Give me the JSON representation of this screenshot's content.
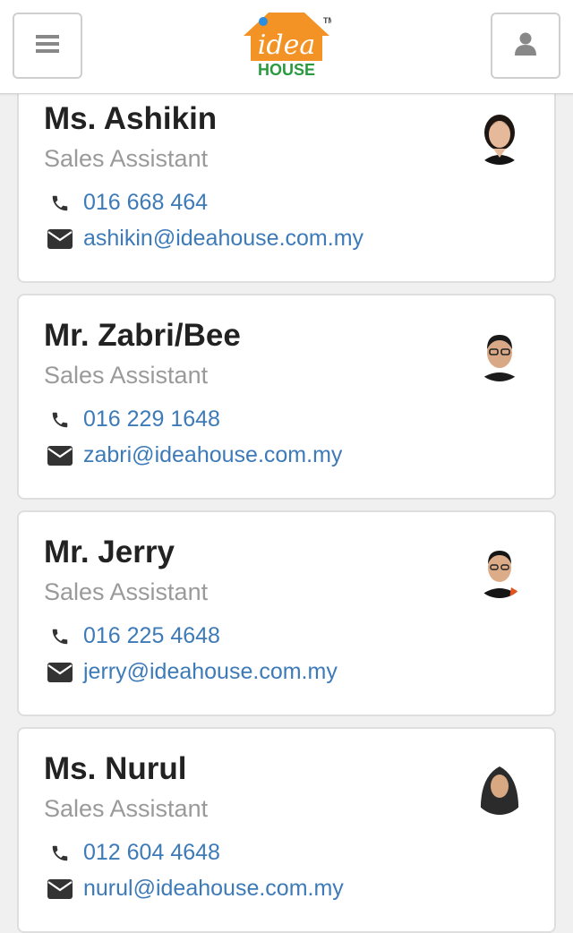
{
  "header": {
    "logo_text": "idea",
    "logo_subtext": "HOUSE",
    "logo_tm": "TM",
    "menu_icon": "hamburger-menu-icon",
    "user_icon": "user-icon"
  },
  "contacts": [
    {
      "name": "Ms. Ashikin",
      "role": "Sales Assistant",
      "phone": "016 668 464",
      "email": "ashikin@ideahouse.com.my"
    },
    {
      "name": "Mr. Zabri/Bee",
      "role": "Sales Assistant",
      "phone": "016 229 1648",
      "email": "zabri@ideahouse.com.my"
    },
    {
      "name": "Mr. Jerry",
      "role": "Sales Assistant",
      "phone": "016 225 4648",
      "email": "jerry@ideahouse.com.my"
    },
    {
      "name": "Ms. Nurul",
      "role": "Sales Assistant",
      "phone": "012 604 4648",
      "email": "nurul@ideahouse.com.my"
    }
  ],
  "colors": {
    "link": "#3d7ab8",
    "logo_orange": "#f39325",
    "logo_green": "#2a9a3f"
  }
}
